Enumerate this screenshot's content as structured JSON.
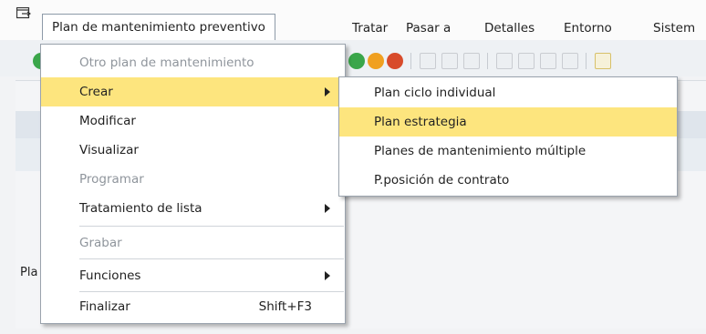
{
  "menubar": {
    "items": [
      {
        "label": "Plan de mantenimiento preventivo",
        "underline": "l",
        "active": true
      },
      {
        "label": "Tratar",
        "underline": "T"
      },
      {
        "label": "Pasar a",
        "underline": "P"
      },
      {
        "label": "Detalles",
        "underline": "D"
      },
      {
        "label": "Entorno",
        "underline": "E"
      },
      {
        "label": "Sistem",
        "underline": "S"
      }
    ]
  },
  "dropdown": {
    "items": [
      {
        "label": "Otro plan de mantenimiento",
        "disabled": true
      },
      {
        "label": "Crear",
        "highlighted": true,
        "submenu": true
      },
      {
        "label": "Modificar"
      },
      {
        "label": "Visualizar"
      },
      {
        "label": "Programar",
        "disabled": true
      },
      {
        "label": "Tratamiento de lista",
        "submenu": true
      },
      {
        "label": "Grabar",
        "disabled": true
      },
      {
        "label": "Funciones",
        "submenu": true
      },
      {
        "label": "Finalizar",
        "shortcut": "Shift+F3"
      }
    ]
  },
  "submenu": {
    "items": [
      {
        "label": "Plan ciclo individual"
      },
      {
        "label": "Plan estrategia",
        "highlighted": true
      },
      {
        "label": "Planes de mantenimiento múltiple"
      },
      {
        "label": "P.posición de contrato"
      }
    ]
  },
  "background": {
    "label": "Pla"
  },
  "colors": {
    "highlight": "#fde57e",
    "green": "#3aa64a",
    "orange": "#f0a020",
    "red": "#d84b2b"
  }
}
